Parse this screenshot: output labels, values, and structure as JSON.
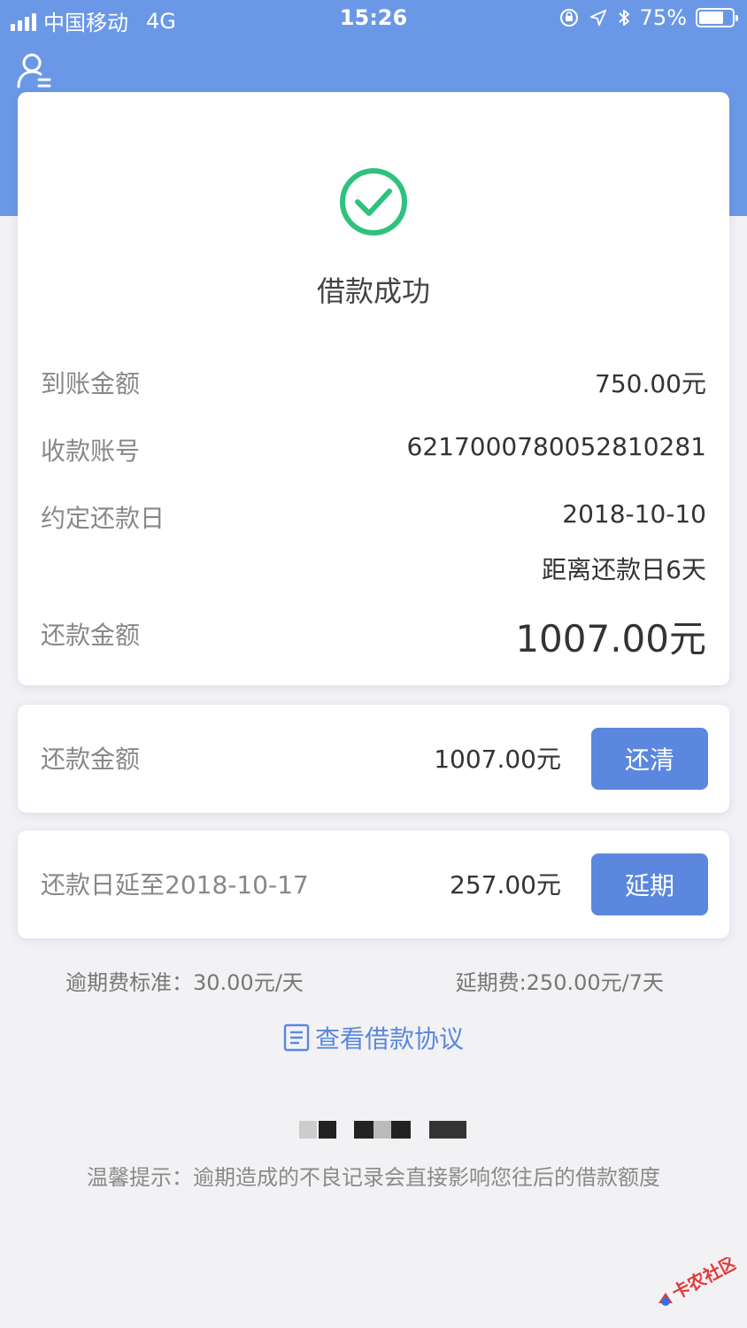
{
  "status_bar": {
    "carrier": "中国移动",
    "network": "4G",
    "time": "15:26",
    "battery": "75%",
    "battery_level": 0.75
  },
  "colors": {
    "header": "#6a98e6",
    "accent": "#5b87de",
    "success": "#2ec27e"
  },
  "icons": [
    "user-menu-icon",
    "check-circle-icon",
    "document-icon",
    "location-arrow-icon",
    "bluetooth-icon",
    "rotation-lock-icon",
    "signal-icon",
    "battery-icon"
  ],
  "loan_result": {
    "title": "借款成功",
    "rows": [
      {
        "label": "到账金额",
        "value": "750.00元"
      },
      {
        "label": "收款账号",
        "value": "6217000780052810281"
      },
      {
        "label": "约定还款日",
        "value": "2018-10-10"
      },
      {
        "label": "",
        "value": "距离还款日6天"
      },
      {
        "label": "还款金额",
        "value": "1007.00元"
      }
    ]
  },
  "repay_card": {
    "label": "还款金额",
    "amount": "1007.00元",
    "button": "还清"
  },
  "extend_card": {
    "label": "还款日延至2018-10-17",
    "amount": "257.00元",
    "button": "延期"
  },
  "fees": {
    "overdue": "逾期费标准：30.00元/天",
    "extension": "延期费:250.00元/7天"
  },
  "agreement_link": "查看借款协议",
  "warm_tip": "温馨提示：逾期造成的不良记录会直接影响您往后的借款额度",
  "watermark": "卡农社区"
}
